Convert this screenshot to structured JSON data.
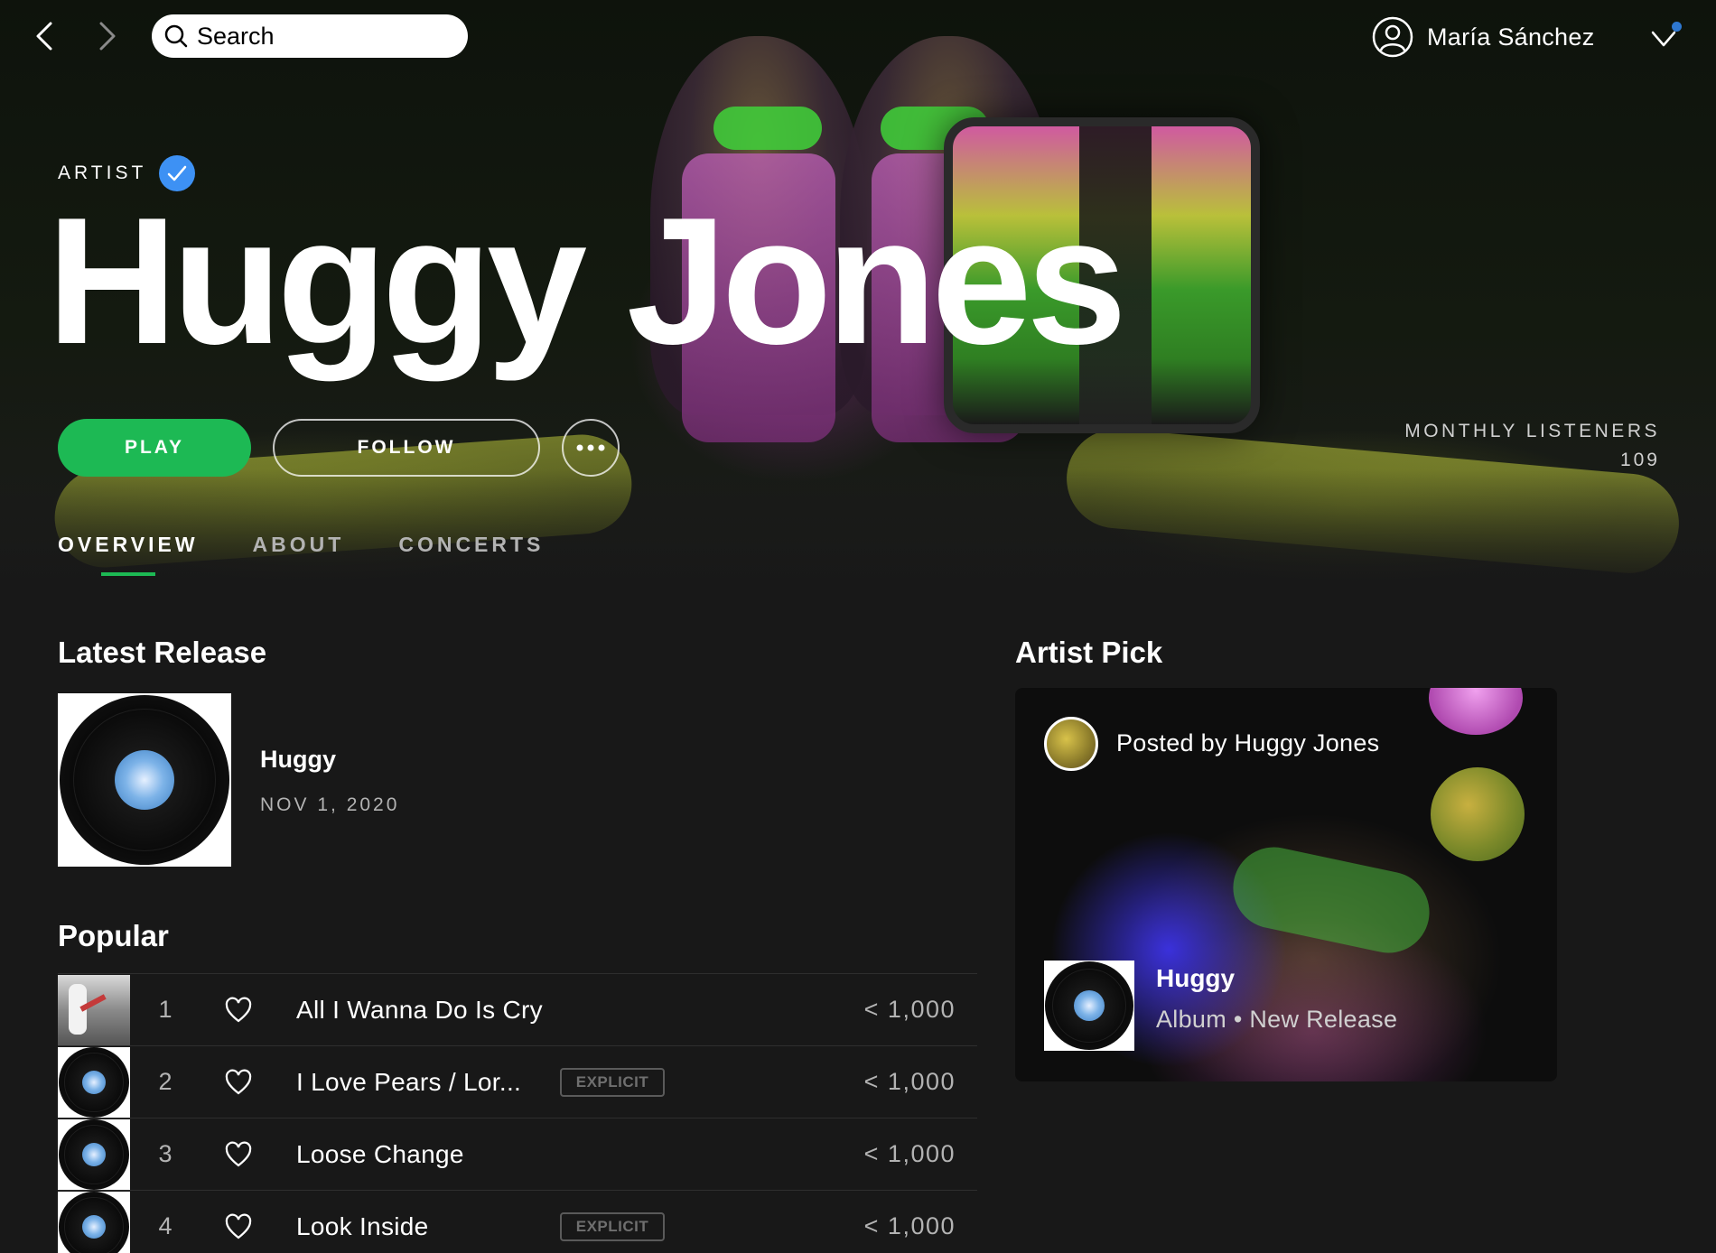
{
  "nav": {
    "back_icon": "chevron-left-icon",
    "forward_icon": "chevron-right-icon"
  },
  "search": {
    "placeholder": "Search",
    "value": ""
  },
  "user": {
    "name": "María Sánchez",
    "avatar_icon": "user-icon",
    "menu_icon": "chevron-down-icon",
    "notification_color": "#2e77d0"
  },
  "artist": {
    "type_label": "ARTIST",
    "verified_icon": "check-icon",
    "name": "Huggy Jones",
    "monthly_listeners_label": "MONTHLY LISTENERS",
    "monthly_listeners": "109"
  },
  "actions": {
    "play_label": "PLAY",
    "follow_label": "FOLLOW",
    "more_icon": "more-icon"
  },
  "tabs": [
    {
      "label": "OVERVIEW",
      "active": true
    },
    {
      "label": "ABOUT",
      "active": false
    },
    {
      "label": "CONCERTS",
      "active": false
    }
  ],
  "latest_release": {
    "heading": "Latest Release",
    "title": "Huggy",
    "date": "NOV 1, 2020"
  },
  "popular": {
    "heading": "Popular",
    "tracks": [
      {
        "num": "1",
        "title": "All I Wanna Do Is Cry",
        "explicit": false,
        "plays": "< 1,000"
      },
      {
        "num": "2",
        "title": "I Love Pears / Lor...",
        "explicit": true,
        "explicit_label": "EXPLICIT",
        "plays": "< 1,000"
      },
      {
        "num": "3",
        "title": "Loose Change",
        "explicit": false,
        "plays": "< 1,000"
      },
      {
        "num": "4",
        "title": "Look Inside",
        "explicit": true,
        "explicit_label": "EXPLICIT",
        "plays": "< 1,000"
      }
    ]
  },
  "artist_pick": {
    "heading": "Artist Pick",
    "posted_by": "Posted by Huggy Jones",
    "title": "Huggy",
    "subtitle": "Album • New Release"
  },
  "colors": {
    "accent": "#1db954",
    "verified": "#3d91f4",
    "background": "#181818"
  }
}
